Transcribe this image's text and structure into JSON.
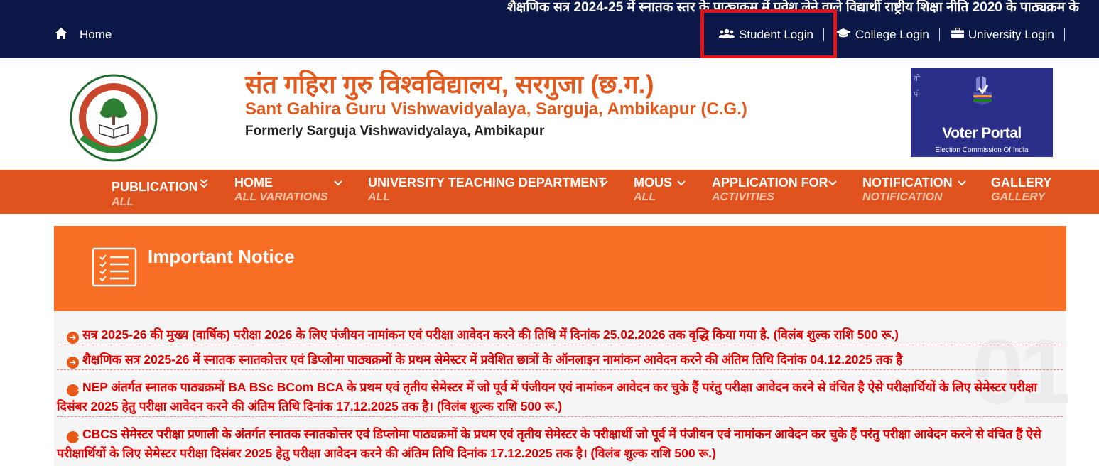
{
  "topbar": {
    "marquee": "शैक्षणिक सत्र 2024-25 में स्नातक स्तर के पाठ्यक्रम में प्रवेश लेने वाले विद्यार्थी राष्ट्रीय शिक्षा नीति 2020 के पाठ्यक्रम के",
    "home_label": "Home",
    "logins": [
      {
        "label": "Student Login",
        "icon": "users-icon"
      },
      {
        "label": "College Login",
        "icon": "graduation-cap-icon"
      },
      {
        "label": "University Login",
        "icon": "briefcase-icon"
      }
    ],
    "highlight_color": "#e0141b"
  },
  "header": {
    "title_hindi": "संत गहिरा गुरु विश्वविद्यालय, सरगुजा (छ.ग.)",
    "title_english": "Sant Gahira Guru Vishwavidyalaya, Sarguja, Ambikapur (C.G.)",
    "formerly": "Formerly Sarguja Vishwavidyalaya, Ambikapur",
    "voter_portal": {
      "title": "Voter Portal",
      "subtitle": "Election Commission Of India"
    }
  },
  "nav": {
    "items": [
      {
        "label": "PUBLICATION",
        "sub": "ALL"
      },
      {
        "label": "HOME",
        "sub": "ALL VARIATIONS"
      },
      {
        "label": "UNIVERSITY TEACHING DEPARTMENT",
        "sub": "ALL"
      },
      {
        "label": "MOUS",
        "sub": "ALL"
      },
      {
        "label": "APPLICATION FOR",
        "sub": "ACTIVITIES"
      },
      {
        "label": "NOTIFICATION",
        "sub": "NOTIFICATION"
      },
      {
        "label": "GALLERY",
        "sub": "GALLERY"
      }
    ]
  },
  "notice": {
    "title": "Important Notice",
    "items": [
      "सत्र 2025-26 की मुख्य (वार्षिक) परीक्षा 2026 के लिए पंजीयन नामांकन एवं परीक्षा आवेदन करने की तिथि में दिनांक 25.02.2026 तक वृद्धि किया गया है. (विलंब शुल्क राशि 500 रू.)",
      "शैक्षणिक सत्र 2025-26 में स्नातक स्नातकोत्तर एवं डिप्लोमा पाठ्यक्रमों के प्रथम सेमेस्टर में प्रवेशित छात्रों के ऑनलाइन नामांकन आवेदन करने की अंतिम तिथि दिनांक 04.12.2025 तक है",
      "NEP अंतर्गत स्नातक पाठ्यक्रमों BA BSc BCom BCA के प्रथम एवं तृतीय सेमेस्टर में जो पूर्व में पंजीयन एवं नामांकन आवेदन कर चुके हैं परंतु परीक्षा आवेदन करने से वंचित है ऐसे परीक्षार्थियों के लिए सेमेस्टर परीक्षा दिसंबर 2025 हेतु परीक्षा आवेदन करने की अंतिम तिथि दिनांक 17.12.2025 तक है। (विलंब शुल्क राशि 500 रू.)",
      "CBCS सेमेस्टर परीक्षा प्रणाली के अंतर्गत स्नातक स्नातकोत्तर एवं डिप्लोमा पाठ्यक्रमों के प्रथम एवं तृतीय सेमेस्टर के परीक्षार्थी जो पूर्व में पंजीयन एवं नामांकन आवेदन कर चुके हैं परंतु परीक्षा आवेदन करने से वंचित हैं ऐसे परीक्षार्थियों के लिए सेमेस्टर परीक्षा दिसंबर 2025 हेतु परीक्षा आवेदन करने की अंतिम तिथि दिनांक 17.12.2025 तक है। (विलंब शुल्क राशि 500 रू.)"
    ]
  },
  "colors": {
    "topbar_bg": "#0b1848",
    "brand_orange": "#e05a1e",
    "nav_bg": "#e0521e",
    "notice_bg": "#f96e25",
    "notice_text": "#e00000"
  }
}
